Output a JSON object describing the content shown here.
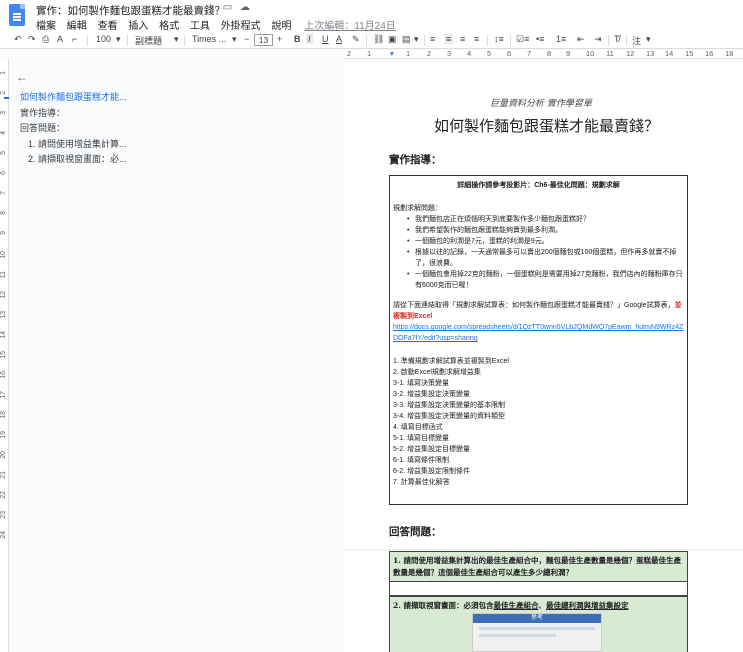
{
  "app": {
    "doc_title": "實作：如何製作麵包跟蛋糕才能最賣錢？",
    "icons": [
      "star-icon",
      "folder-icon",
      "cloud-icon"
    ],
    "menu": [
      "檔案",
      "編輯",
      "查看",
      "插入",
      "格式",
      "工具",
      "外掛程式",
      "說明"
    ],
    "last_edit": "上次編輯：11月24日"
  },
  "toolbar": {
    "zoom": "100",
    "style": "副標題",
    "font": "Times ...",
    "font_size": "13",
    "mode": "注"
  },
  "ruler": [
    "2",
    "1",
    "1",
    "2",
    "3",
    "4",
    "5",
    "6",
    "7",
    "8",
    "9",
    "10",
    "11",
    "12",
    "13",
    "14",
    "15",
    "16",
    "17",
    "18"
  ],
  "vruler": [
    "1",
    "2",
    "3",
    "4",
    "5",
    "6",
    "7",
    "8",
    "9",
    "10",
    "11",
    "12",
    "13",
    "14",
    "15",
    "16",
    "17",
    "18",
    "19",
    "20",
    "21",
    "22",
    "23",
    "24"
  ],
  "outline": {
    "items": [
      {
        "label": "如何製作麵包跟蛋糕才能..."
      },
      {
        "label": "實作指導："
      },
      {
        "label": "回答問題："
      },
      {
        "label": "1. 請問使用增益集計算..."
      },
      {
        "label": "2. 請擷取視窗畫面：必..."
      }
    ]
  },
  "doc": {
    "subtitle": "巨量資料分析 實作學習單",
    "title": "如何製作麵包跟蛋糕才能最賣錢？",
    "section1": "實作指導：",
    "box": {
      "header": "詳細操作請參考投影片：Ch6-最佳化問題：規劃求解",
      "problem_label": "規劃求解問題：",
      "bullets": [
        "我們麵包店正在煩惱明天到底要製作多少麵包跟蛋糕好？",
        "我們希望製作的麵包跟蛋糕能夠賣到最多利潤。",
        "一個麵包的利潤是7元，蛋糕的利潤是9元。",
        "根據以往的記錄，一天通常最多可以賣出200個麵包或100個蛋糕，但作再多就賣不掉了，很浪費。",
        "一個麵包會用掉22克的麵粉，一個蛋糕則是需要用掉27克麵粉，我們店內的麵粉庫存只有6000克而已喔！"
      ],
      "instruction": "請從下面連結取得「規劃求解試算表：如何製作麵包跟蛋糕才能最賣錢？」Google試算表，",
      "instruction_red": "並複製到Excel",
      "link": "https://docs.google.com/spreadsheets/d/1QzTT0wnn5VLb2QMdWQ7pEawm_hutmN9WRz4ZDOFa7fY/edit?usp=sharing",
      "steps": [
        "1. 準備規劃求解試算表並複製到Excel",
        "2. 啟動Excel規劃求解增益集",
        "3-1. 填寫決策變量",
        "3-2. 增益集設定決策變量",
        "3-3. 增益集設定決策變量的基本限制",
        "3-4. 增益集設定決策變量的資料類型",
        "4. 填寫目標函式",
        "5-1. 填寫目標變量",
        "5-2. 增益集設定目標變量",
        "6-1. 填寫條件限制",
        "6-2. 增益集設定限制條件",
        "7. 計算最佳化解答"
      ]
    },
    "section2": "回答問題：",
    "q1": "1. 請問使用增益集計算出的最佳生產組合中，麵包最佳生產數量是幾個？蛋糕最佳生產數量是幾個？這個最佳生產組合可以產生多少總利潤？",
    "q2_prefix": "2. 請擷取視窗畫面：必須包含",
    "q2_u1": "最佳生產組合",
    "q2_sep": "、",
    "q2_u2": "最佳總利潤與增益集設定",
    "thumb_title": "參考"
  }
}
